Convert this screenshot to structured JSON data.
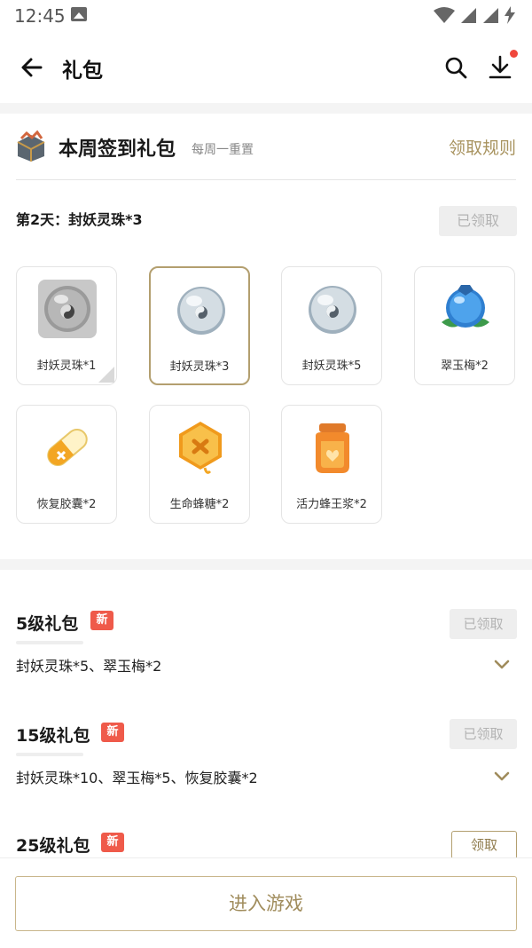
{
  "status_bar": {
    "time": "12:45"
  },
  "app_bar": {
    "title": "礼包"
  },
  "signin": {
    "title": "本周签到礼包",
    "subtitle": "每周一重置",
    "rules_link": "领取规则",
    "current_day": "第2天：封妖灵珠*3",
    "claimed_label": "已领取",
    "items": [
      {
        "label": "封妖灵珠*1",
        "icon": "spirit-orb-icon",
        "state": "claimed"
      },
      {
        "label": "封妖灵珠*3",
        "icon": "spirit-orb-icon",
        "state": "current"
      },
      {
        "label": "封妖灵珠*5",
        "icon": "spirit-orb-icon",
        "state": "upcoming"
      },
      {
        "label": "翠玉梅*2",
        "icon": "jade-plum-icon",
        "state": "upcoming"
      },
      {
        "label": "恢复胶囊*2",
        "icon": "capsule-icon",
        "state": "upcoming"
      },
      {
        "label": "生命蜂糖*2",
        "icon": "honeycomb-icon",
        "state": "upcoming"
      },
      {
        "label": "活力蜂王浆*2",
        "icon": "honey-jar-icon",
        "state": "upcoming"
      }
    ]
  },
  "level_gifts": [
    {
      "name": "5级礼包",
      "badge": "新",
      "desc": "封妖灵珠*5、翠玉梅*2",
      "button": "已领取",
      "claimed": true
    },
    {
      "name": "15级礼包",
      "badge": "新",
      "desc": "封妖灵珠*10、翠玉梅*5、恢复胶囊*2",
      "button": "已领取",
      "claimed": true
    },
    {
      "name": "25级礼包",
      "badge": "新",
      "desc": "",
      "button": "领取",
      "claimed": false
    }
  ],
  "bottom": {
    "enter_game": "进入游戏"
  },
  "colors": {
    "accent_gold": "#b39f6f",
    "badge_red": "#ef5a4a",
    "notification_dot": "#f0473c"
  }
}
